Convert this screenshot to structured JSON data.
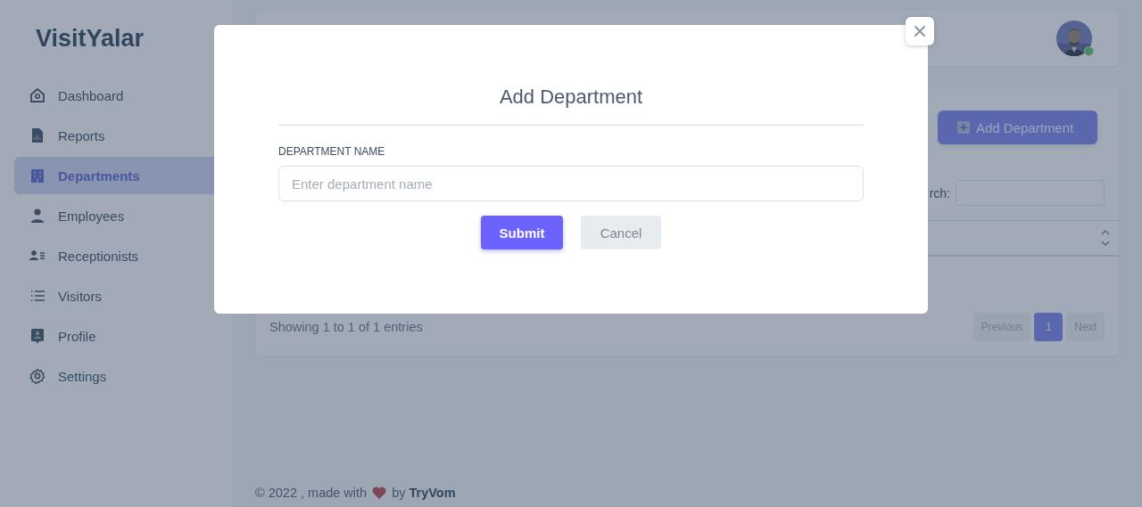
{
  "sidebar": {
    "logo": "VisitYalar",
    "items": [
      {
        "label": "Dashboard",
        "kind": "home",
        "selected": false
      },
      {
        "label": "Reports",
        "kind": "report",
        "selected": false
      },
      {
        "label": "Departments",
        "kind": "building",
        "selected": true
      },
      {
        "label": "Employees",
        "kind": "person",
        "selected": false
      },
      {
        "label": "Receptionists",
        "kind": "roster",
        "selected": false
      },
      {
        "label": "Visitors",
        "kind": "list",
        "selected": false
      },
      {
        "label": "Profile",
        "kind": "profile",
        "selected": false
      },
      {
        "label": "Settings",
        "kind": "gear",
        "selected": false
      }
    ]
  },
  "header": {
    "avatar": {
      "kind": "picture",
      "online": true
    }
  },
  "departments_card": {
    "add_button": "Add Department",
    "search_label": "rch:",
    "info": "Showing 1 to 1 of 1 entries",
    "pagination": [
      {
        "label": "Previous",
        "selected": false
      },
      {
        "label": "1",
        "selected": true
      },
      {
        "label": "Next",
        "selected": false
      }
    ]
  },
  "footer": {
    "text": "© 2022 , made with",
    "credit": "by **TryVom**"
  },
  "modal": {
    "title": "Add Department",
    "field": {
      "label": "DEPARTMENT NAME",
      "placeholder": "Enter department name"
    },
    "buttons": [
      {
        "label": "Submit",
        "kind": "primary"
      },
      {
        "label": "Cancel",
        "kind": "secondary"
      }
    ]
  }
}
